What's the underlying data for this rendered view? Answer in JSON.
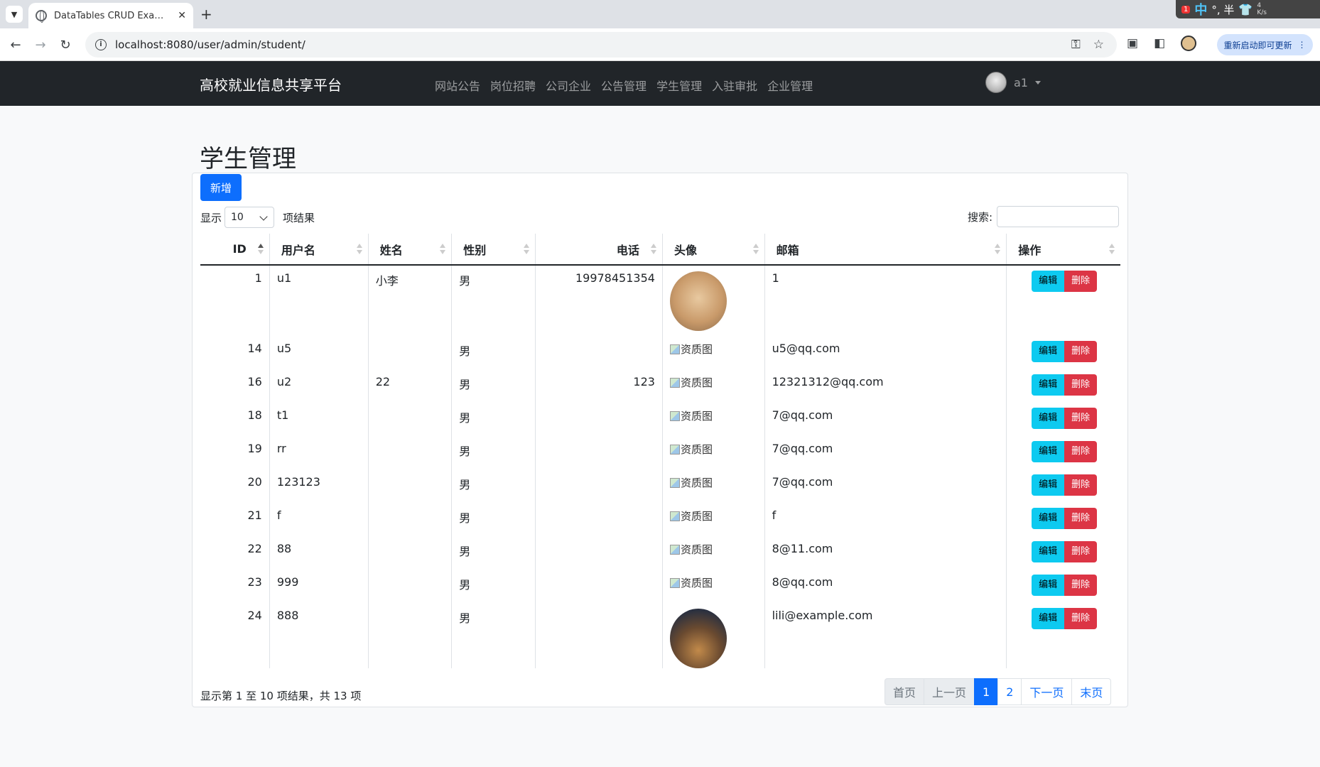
{
  "browser": {
    "tab_title": "DataTables CRUD Example w",
    "url": "localhost:8080/user/admin/student/",
    "update_label": "重新启动即可更新",
    "tray": {
      "badge": "1",
      "ime": "中",
      "punct": "°, 半",
      "speed_top": "4",
      "speed_bottom": "K/s"
    }
  },
  "navbar": {
    "brand": "高校就业信息共享平台",
    "links": [
      "网站公告",
      "岗位招聘",
      "公司企业",
      "公告管理",
      "学生管理",
      "入驻审批",
      "企业管理"
    ],
    "user": "a1"
  },
  "page": {
    "title": "学生管理",
    "add_button": "新增",
    "length_prefix": "显示",
    "length_value": "10",
    "length_suffix": "项结果",
    "search_label": "搜索:"
  },
  "table": {
    "headers": [
      "ID",
      "用户名",
      "姓名",
      "性别",
      "电话",
      "头像",
      "邮箱",
      "操作"
    ],
    "edit_label": "编辑",
    "delete_label": "删除",
    "broken_img_alt": "资质图",
    "rows": [
      {
        "id": "1",
        "username": "u1",
        "name": "小李",
        "gender": "男",
        "phone": "19978451354",
        "avatar": "image-meme",
        "email": "1"
      },
      {
        "id": "14",
        "username": "u5",
        "name": "",
        "gender": "男",
        "phone": "",
        "avatar": "broken",
        "email": "u5@qq.com"
      },
      {
        "id": "16",
        "username": "u2",
        "name": "22",
        "gender": "男",
        "phone": "123",
        "avatar": "broken",
        "email": "12321312@qq.com"
      },
      {
        "id": "18",
        "username": "t1",
        "name": "",
        "gender": "男",
        "phone": "",
        "avatar": "broken",
        "email": "7@qq.com"
      },
      {
        "id": "19",
        "username": "rr",
        "name": "",
        "gender": "男",
        "phone": "",
        "avatar": "broken",
        "email": "7@qq.com"
      },
      {
        "id": "20",
        "username": "123123",
        "name": "",
        "gender": "男",
        "phone": "",
        "avatar": "broken",
        "email": "7@qq.com"
      },
      {
        "id": "21",
        "username": "f",
        "name": "",
        "gender": "男",
        "phone": "",
        "avatar": "broken",
        "email": "f"
      },
      {
        "id": "22",
        "username": "88",
        "name": "",
        "gender": "男",
        "phone": "",
        "avatar": "broken",
        "email": "8@11.com"
      },
      {
        "id": "23",
        "username": "999",
        "name": "",
        "gender": "男",
        "phone": "",
        "avatar": "broken",
        "email": "8@qq.com"
      },
      {
        "id": "24",
        "username": "888",
        "name": "",
        "gender": "男",
        "phone": "",
        "avatar": "image-cat",
        "email": "lili@example.com"
      }
    ]
  },
  "footer": {
    "info": "显示第 1 至 10 项结果，共 13 项",
    "pager": {
      "first": "首页",
      "prev": "上一页",
      "page1": "1",
      "page2": "2",
      "next": "下一页",
      "last": "末页"
    }
  }
}
